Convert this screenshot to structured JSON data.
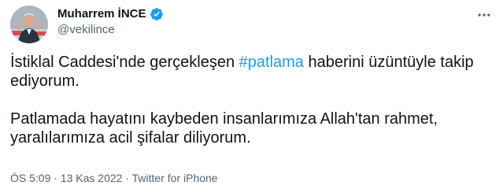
{
  "tweet": {
    "author": {
      "display_name": "Muharrem İNCE",
      "handle": "@vekilince",
      "verified": true
    },
    "text": {
      "para1_prefix": "İstiklal Caddesi'nde gerçekleşen ",
      "hashtag": "#patlama",
      "para1_suffix": " haberini üzüntüyle takip ediyorum.",
      "para2": "Patlamada hayatını kaybeden insanlarımıza Allah'tan rahmet, yaralılarımıza acil şifalar diliyorum."
    },
    "meta": {
      "time": "ÖS 5:09",
      "separator": " · ",
      "date": "13 Kas 2022",
      "source": "Twitter for iPhone"
    },
    "icons": {
      "verified": "verified-badge-icon",
      "more": "more-options-icon"
    },
    "colors": {
      "accent": "#1d9bf0",
      "text": "#0f1419",
      "secondary": "#536471"
    }
  }
}
